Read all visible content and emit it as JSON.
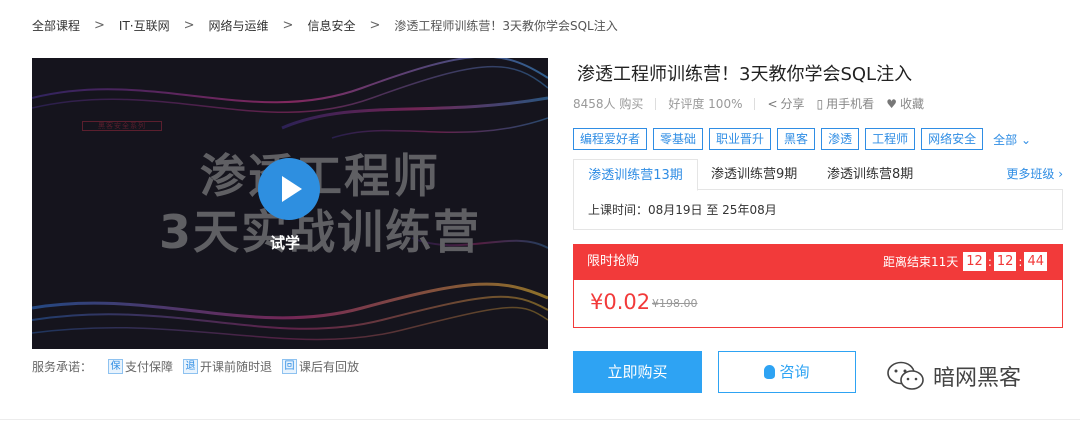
{
  "breadcrumb": {
    "items": [
      "全部课程",
      "IT·互联网",
      "网络与运维",
      "信息安全",
      "渗透工程师训练营！3天教你学会SQL注入"
    ],
    "separator": ">"
  },
  "video": {
    "tiny_label": "黑客安全系列",
    "title_line1": "渗透工程师",
    "title_line2": "3天实战训练营",
    "trial_label": "试学"
  },
  "service": {
    "label": "服务承诺：",
    "items": [
      {
        "icon": "保",
        "icon_name": "payment-guarantee-icon",
        "text": "支付保障"
      },
      {
        "icon": "退",
        "icon_name": "refund-icon",
        "text": "开课前随时退"
      },
      {
        "icon": "回",
        "icon_name": "replay-icon",
        "text": "课后有回放"
      }
    ]
  },
  "course": {
    "title": "渗透工程师训练营！3天教你学会SQL注入",
    "buyers": "8458人 购买",
    "rating": "好评度 100%",
    "share": "分享",
    "mobile": "用手机看",
    "favorite": "收藏"
  },
  "tags": {
    "items": [
      "编程爱好者",
      "零基础",
      "职业晋升",
      "黑客",
      "渗透",
      "工程师",
      "网络安全"
    ],
    "all_label": "全部"
  },
  "classes": {
    "tabs": [
      "渗透训练营13期",
      "渗透训练营9期",
      "渗透训练营8期"
    ],
    "more_label": "更多班级",
    "schedule": "上课时间：08月19日 至 25年08月"
  },
  "sale": {
    "label": "限时抢购",
    "countdown_label": "距离结束11天",
    "hours": "12",
    "minutes": "12",
    "seconds": "44",
    "price": "¥0.02",
    "original_price": "¥198.00"
  },
  "actions": {
    "buy_label": "立即购买",
    "consult_label": "咨询"
  },
  "watermark": {
    "text": "暗网黑客"
  },
  "colors": {
    "accent": "#2f8de4",
    "button": "#2ea3f3",
    "sale": "#f23a3a"
  }
}
